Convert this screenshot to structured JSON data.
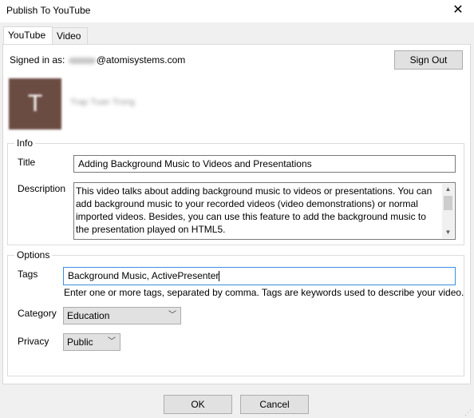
{
  "window": {
    "title": "Publish To YouTube"
  },
  "tabs": [
    {
      "label": "YouTube"
    },
    {
      "label": "Video"
    }
  ],
  "account": {
    "signed_in_label": "Signed in as:",
    "email_domain": "@atomisystems.com",
    "sign_out_label": "Sign Out",
    "avatar_initial": "T",
    "name": "Trap Tuan Trong"
  },
  "info": {
    "legend": "Info",
    "title_label": "Title",
    "title_value": "Adding Background Music to Videos and Presentations",
    "description_label": "Description",
    "description_value": "This video talks about adding background music to videos or presentations. You can add background music to your recorded videos (video demonstrations) or normal imported videos. Besides, you can use this feature to add the background music to the presentation played on HTML5."
  },
  "options": {
    "legend": "Options",
    "tags_label": "Tags",
    "tags_value": "Background Music, ActivePresenter",
    "tags_hint": "Enter one or more tags, separated by comma. Tags are keywords used to describe your video.",
    "category_label": "Category",
    "category_value": "Education",
    "privacy_label": "Privacy",
    "privacy_value": "Public"
  },
  "footer": {
    "ok_label": "OK",
    "cancel_label": "Cancel"
  },
  "colors": {
    "focus_border": "#3c8ee3",
    "avatar_bg": "#6b4c43"
  }
}
